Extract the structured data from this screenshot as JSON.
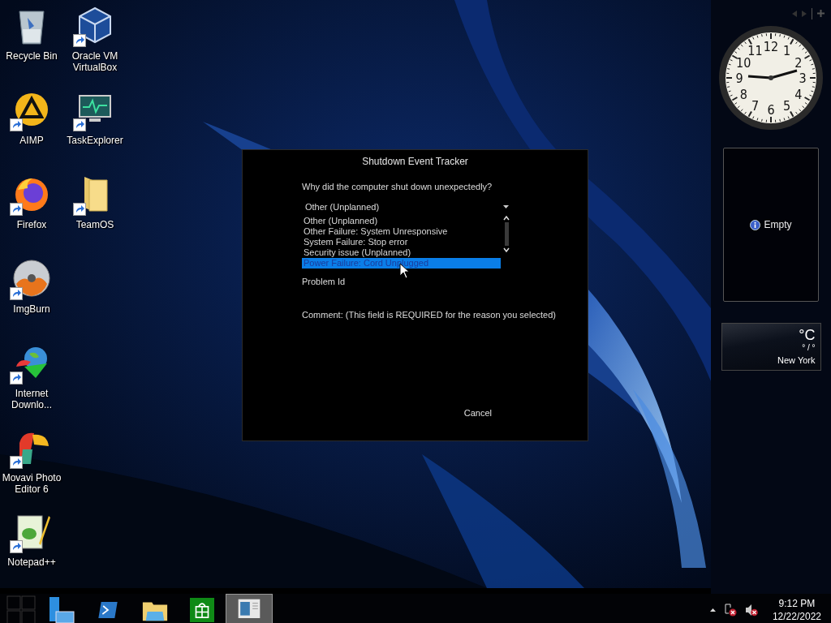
{
  "desktop_columns": [
    {
      "icons": [
        {
          "label": "Recycle Bin",
          "shortcut": false
        },
        {
          "label": "AIMP",
          "shortcut": true
        },
        {
          "label": "Firefox",
          "shortcut": true
        },
        {
          "label": "ImgBurn",
          "shortcut": true
        },
        {
          "label": "Internet Downlo...",
          "shortcut": true
        },
        {
          "label": "Movavi Photo Editor 6",
          "shortcut": true
        },
        {
          "label": "Notepad++",
          "shortcut": true
        }
      ]
    },
    {
      "icons": [
        {
          "label": "Oracle VM VirtualBox",
          "shortcut": true
        },
        {
          "label": "TaskExplorer",
          "shortcut": true
        },
        {
          "label": "TeamOS",
          "shortcut": true
        }
      ]
    }
  ],
  "dialog": {
    "title": "Shutdown Event Tracker",
    "question": "Why did the computer shut down unexpectedly?",
    "dropdown": {
      "value": "Other (Unplanned)"
    },
    "reasons": [
      {
        "label": "Other (Unplanned)",
        "selected": false
      },
      {
        "label": "Other Failure: System Unresponsive",
        "selected": false
      },
      {
        "label": "System Failure: Stop error",
        "selected": false
      },
      {
        "label": "Security issue (Unplanned)",
        "selected": false
      },
      {
        "label": "Power Failure: Cord Unplugged",
        "selected": true
      }
    ],
    "problem_label": "Problem Id",
    "comment_label": "Comment: (This field is REQUIRED for the reason you selected)",
    "buttons": [
      "Cancel"
    ]
  },
  "gadgets": {
    "clock": {
      "numerals": [
        "12",
        "11",
        "1",
        "10",
        "2",
        "9",
        "3",
        "8",
        "4",
        "7",
        "5",
        "6"
      ]
    },
    "slideshow": {
      "message": "Empty"
    },
    "weather": {
      "unit": "°C",
      "range": "° / °",
      "city": "New York"
    }
  },
  "taskbar": {
    "apps": [
      {
        "selected": false
      },
      {
        "selected": false
      },
      {
        "selected": false
      },
      {
        "selected": false
      },
      {
        "selected": false
      },
      {
        "selected": true
      }
    ],
    "tray": {
      "network_disconnected": true,
      "volume_muted": true,
      "time": "9:12 PM",
      "date": "12/22/2022"
    }
  }
}
